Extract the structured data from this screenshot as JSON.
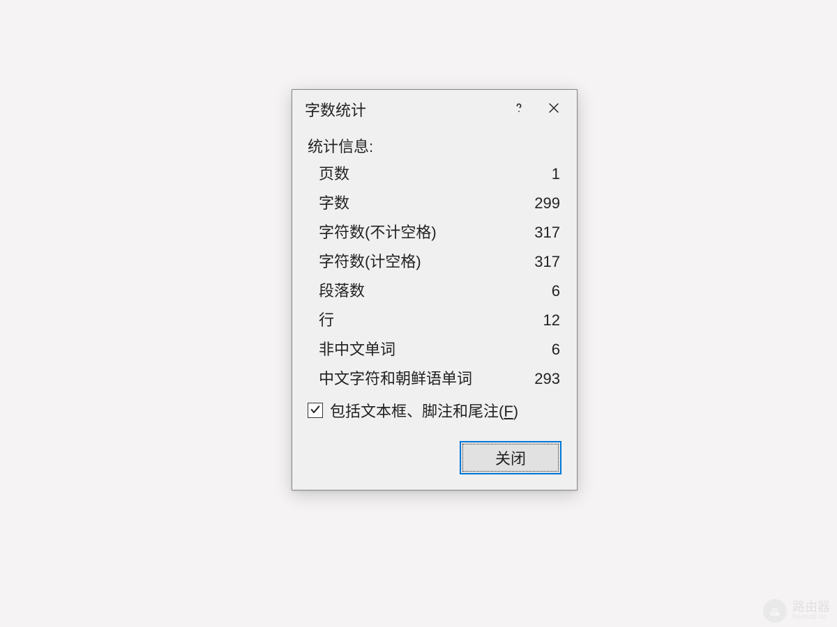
{
  "dialog": {
    "title": "字数统计",
    "section_label": "统计信息:",
    "stats": [
      {
        "label": "页数",
        "value": "1"
      },
      {
        "label": "字数",
        "value": "299"
      },
      {
        "label": "字符数(不计空格)",
        "value": "317"
      },
      {
        "label": "字符数(计空格)",
        "value": "317"
      },
      {
        "label": "段落数",
        "value": "6"
      },
      {
        "label": "行",
        "value": "12"
      },
      {
        "label": "非中文单词",
        "value": "6"
      },
      {
        "label": "中文字符和朝鲜语单词",
        "value": "293"
      }
    ],
    "checkbox": {
      "checked": true,
      "label_prefix": "包括文本框、脚注和尾注(",
      "label_accel": "F",
      "label_suffix": ")"
    },
    "close_label": "关闭"
  },
  "watermark": {
    "main": "路由器",
    "sub": "luyouqi.cc"
  }
}
